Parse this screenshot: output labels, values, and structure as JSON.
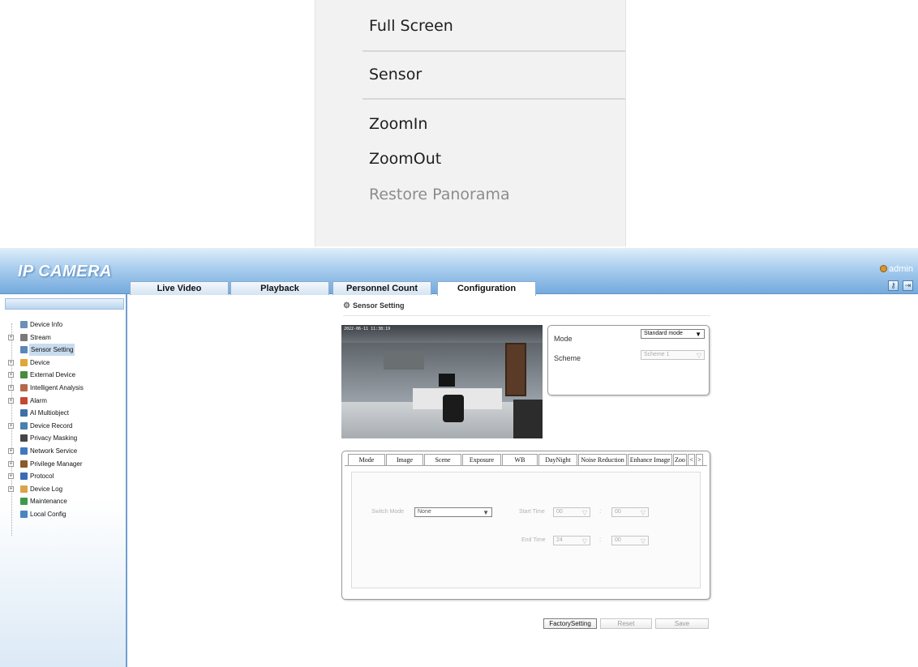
{
  "context_menu": {
    "items": [
      {
        "label": "Full Screen",
        "enabled": true
      },
      {
        "label": "Sensor",
        "enabled": true
      },
      {
        "label": "ZoomIn",
        "enabled": true
      },
      {
        "label": "ZoomOut",
        "enabled": true
      },
      {
        "label": "Restore Panorama",
        "enabled": false
      }
    ]
  },
  "header": {
    "logo": "IP CAMERA",
    "tabs": [
      {
        "label": "Live Video",
        "active": false
      },
      {
        "label": "Playback",
        "active": false
      },
      {
        "label": "Personnel Count",
        "active": false
      },
      {
        "label": "Configuration",
        "active": true
      }
    ],
    "user": "admin",
    "icons": [
      "key-icon",
      "logout-icon"
    ]
  },
  "sidebar": {
    "items": [
      {
        "label": "Device Info",
        "expandable": false,
        "icon": "device-info-icon",
        "color": "#6d8fb8"
      },
      {
        "label": "Stream",
        "expandable": true,
        "icon": "stream-icon",
        "color": "#7a7a7a"
      },
      {
        "label": "Sensor Setting",
        "expandable": false,
        "icon": "sensor-setting-icon",
        "color": "#5b86b8",
        "selected": true
      },
      {
        "label": "Device",
        "expandable": true,
        "icon": "device-icon",
        "color": "#e0a637"
      },
      {
        "label": "External Device",
        "expandable": true,
        "icon": "external-device-icon",
        "color": "#4a8a3e"
      },
      {
        "label": "Intelligent Analysis",
        "expandable": true,
        "icon": "intelligent-analysis-icon",
        "color": "#b46a4a"
      },
      {
        "label": "Alarm",
        "expandable": true,
        "icon": "alarm-icon",
        "color": "#c2492f"
      },
      {
        "label": "AI Multiobject",
        "expandable": false,
        "icon": "ai-multiobject-icon",
        "color": "#3e6fa8"
      },
      {
        "label": "Device Record",
        "expandable": true,
        "icon": "device-record-icon",
        "color": "#4a7fb0"
      },
      {
        "label": "Privacy Masking",
        "expandable": false,
        "icon": "privacy-masking-icon",
        "color": "#454545"
      },
      {
        "label": "Network Service",
        "expandable": true,
        "icon": "network-service-icon",
        "color": "#3f78c0"
      },
      {
        "label": "Privilege Manager",
        "expandable": true,
        "icon": "privilege-manager-icon",
        "color": "#8a5a2a"
      },
      {
        "label": "Protocol",
        "expandable": true,
        "icon": "protocol-icon",
        "color": "#3a6cb5"
      },
      {
        "label": "Device Log",
        "expandable": true,
        "icon": "device-log-icon",
        "color": "#d8a54a"
      },
      {
        "label": "Maintenance",
        "expandable": false,
        "icon": "maintenance-icon",
        "color": "#3c9a4a"
      },
      {
        "label": "Local Config",
        "expandable": false,
        "icon": "local-config-icon",
        "color": "#4a86c0"
      }
    ]
  },
  "main": {
    "section_title": "Sensor Setting",
    "preview": {
      "timestamp": "2022-06-11 11:38:19"
    },
    "mode_panel": {
      "mode_label": "Mode",
      "mode_value": "Standard mode",
      "scheme_label": "Scheme",
      "scheme_value": "Scheme 1"
    },
    "tabs": [
      "Mode",
      "Image",
      "Scene",
      "Exposure",
      "WB",
      "DayNight",
      "Noise Reduction",
      "Enhance Image",
      "Zoo"
    ],
    "tab_scroll": [
      "<",
      ">"
    ],
    "mode_tab": {
      "switch_mode_label": "Switch Mode",
      "switch_mode_value": "None",
      "start_time_label": "Start Time",
      "start_hour": "00",
      "start_minute": "00",
      "end_time_label": "End Time",
      "end_hour": "24",
      "end_minute": "00",
      "colon": ":"
    },
    "buttons": {
      "factory": "FactorySetting",
      "reset": "Reset",
      "save": "Save"
    }
  }
}
